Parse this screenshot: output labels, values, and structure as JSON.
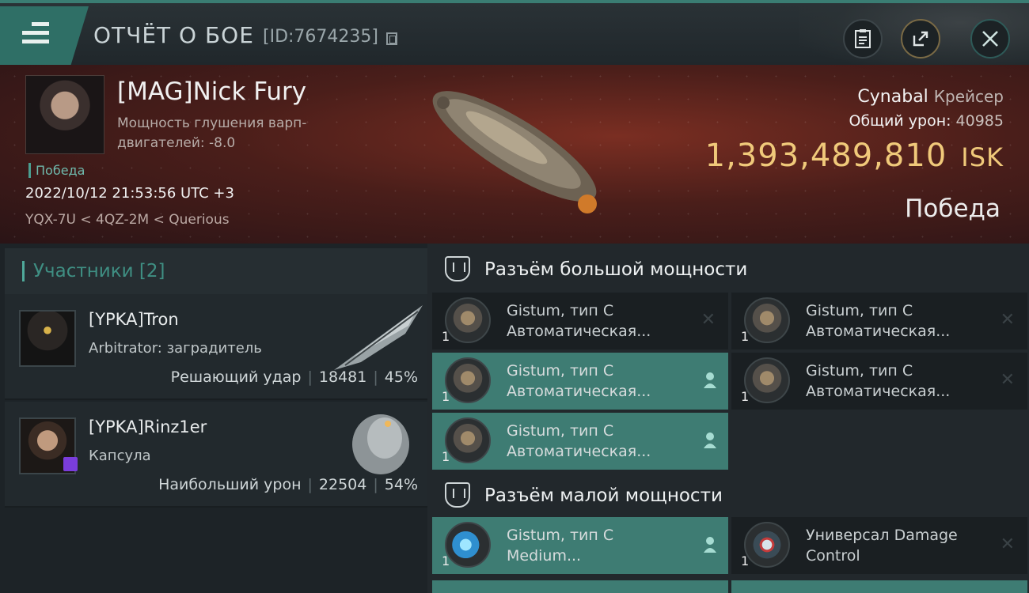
{
  "header": {
    "title": "ОТЧЁТ О БОЕ",
    "report_id": "[ID:7674235]"
  },
  "hero": {
    "pilot_name": "[MAG]Nick Fury",
    "jam_label": "Мощность глушения варп-двигателей: -8.0",
    "result_tag": "Победа",
    "datetime": "2022/10/12 21:53:56 UTC +3",
    "location": "YQX-7U < 4QZ-2M < Querious",
    "ship_name": "Cynabal",
    "ship_class": "Крейсер",
    "total_damage_label": "Общий урон:",
    "total_damage": "40985",
    "isk_value": "1,393,489,810",
    "isk_unit": "ISK",
    "outcome": "Победа"
  },
  "participants": {
    "header": "Участники [2]",
    "rows": [
      {
        "name": "[YPKA]Tron",
        "role": "Arbitrator: заградитель",
        "stat_label": "Решающий удар",
        "damage": "18481",
        "percent": "45%"
      },
      {
        "name": "[YPKA]Rinz1er",
        "role": "Капсула",
        "stat_label": "Наибольший урон",
        "damage": "22504",
        "percent": "54%"
      }
    ]
  },
  "modules": {
    "high_title": "Разъём большой мощности",
    "low_title": "Разъём малой мощности",
    "high": [
      {
        "count": "1",
        "line1": "Gistum, тип C",
        "line2": "Автоматическая...",
        "state": "destroyed"
      },
      {
        "count": "1",
        "line1": "Gistum, тип C",
        "line2": "Автоматическая...",
        "state": "destroyed"
      },
      {
        "count": "1",
        "line1": "Gistum, тип C",
        "line2": "Автоматическая...",
        "state": "dropped"
      },
      {
        "count": "1",
        "line1": "Gistum, тип C",
        "line2": "Автоматическая...",
        "state": "destroyed"
      },
      {
        "count": "1",
        "line1": "Gistum, тип C",
        "line2": "Автоматическая...",
        "state": "dropped"
      }
    ],
    "low": [
      {
        "count": "1",
        "line1": "Gistum, тип C",
        "line2": "Medium...",
        "state": "dropped"
      },
      {
        "count": "1",
        "line1": "Универсал Damage",
        "line2": "Control",
        "state": "destroyed"
      }
    ]
  },
  "colors": {
    "accent": "#3e7c73",
    "isk": "#f0c97a",
    "hero_bg": "#5a2320"
  }
}
